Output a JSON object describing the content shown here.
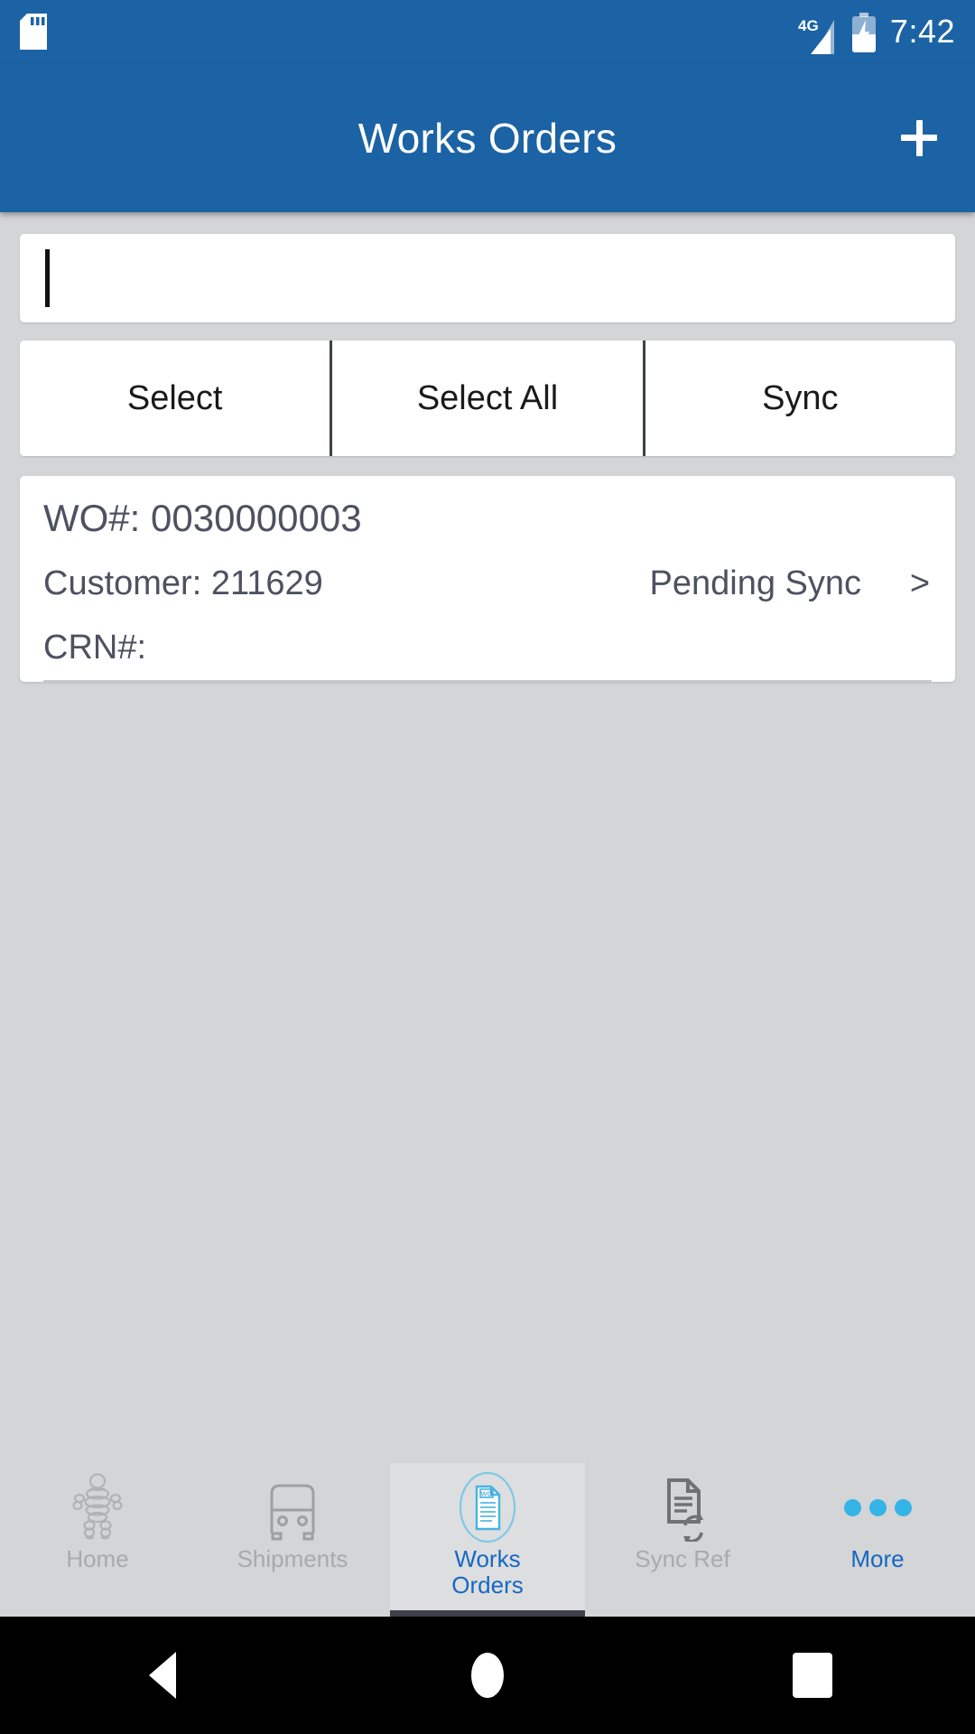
{
  "status_bar": {
    "sd_icon": "sd-card-icon",
    "network_label": "4G",
    "signal_icon": "signal-bars-icon",
    "battery_icon": "battery-charging-icon",
    "time": "7:42"
  },
  "app_bar": {
    "title": "Works Orders",
    "add_icon": "plus-icon"
  },
  "search": {
    "value": "",
    "placeholder": ""
  },
  "action_buttons": [
    {
      "label": "Select",
      "name": "select-button"
    },
    {
      "label": "Select All",
      "name": "select-all-button"
    },
    {
      "label": "Sync",
      "name": "sync-button"
    }
  ],
  "work_orders": [
    {
      "wo_label": "WO#: 0030000003",
      "customer_label": "Customer: 211629",
      "status_label": "Pending Sync",
      "chevron": ">",
      "crn_label": "CRN#:"
    }
  ],
  "tabs": [
    {
      "label": "Home",
      "icon": "michelin-man-icon",
      "active": false
    },
    {
      "label": "Shipments",
      "icon": "truck-icon",
      "active": false
    },
    {
      "label": "Works\nOrders",
      "line1": "Works",
      "line2": "Orders",
      "icon": "works-order-document-icon",
      "active": true
    },
    {
      "label": "Sync Ref",
      "icon": "document-sync-icon",
      "active": false
    },
    {
      "label": "More",
      "icon": "three-dots-icon",
      "active": false
    }
  ],
  "android_nav": {
    "back": "back-triangle-icon",
    "home": "home-circle-icon",
    "recents": "recents-square-icon"
  },
  "colors": {
    "primary": "#1b63a4",
    "accent": "#1668c4",
    "background": "#d4d5d6",
    "card": "#ffffff",
    "text": "#4d5160",
    "muted": "#a9aaac",
    "divider": "#3e4149",
    "dots": "#35b4e8"
  }
}
